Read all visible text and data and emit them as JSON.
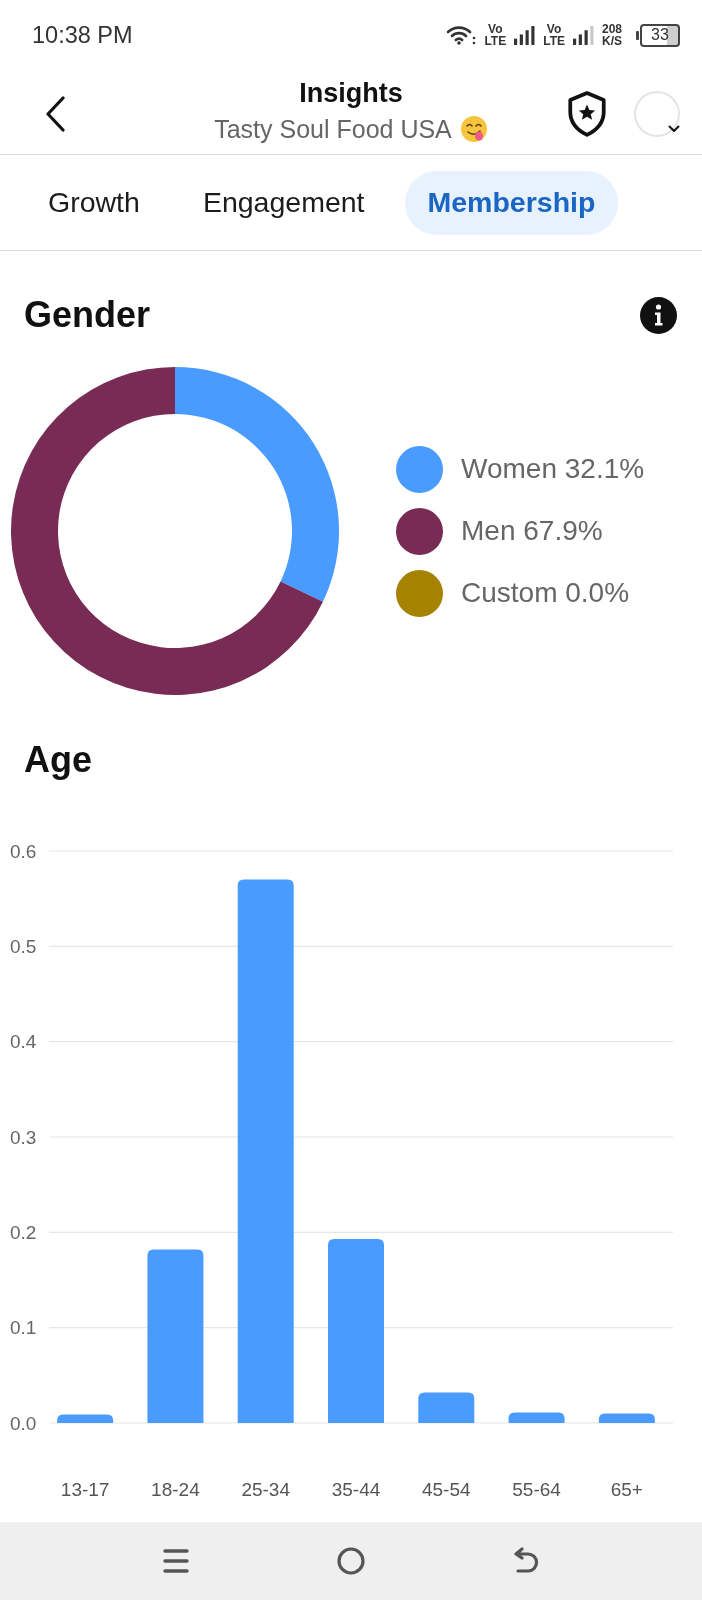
{
  "status_bar": {
    "time": "10:38 PM",
    "sims": [
      {
        "top": "Vo",
        "bottom": "LTE"
      },
      {
        "top": "Vo",
        "bottom": "LTE"
      }
    ],
    "speed": {
      "value": "208",
      "unit": "K/S"
    },
    "battery": "33"
  },
  "header": {
    "title": "Insights",
    "subtitle": "Tasty Soul Food USA"
  },
  "tabs": [
    {
      "label": "Growth",
      "selected": false
    },
    {
      "label": "Engagement",
      "selected": false
    },
    {
      "label": "Membership",
      "selected": true
    }
  ],
  "gender": {
    "title": "Gender",
    "legend": [
      {
        "color": "#4a9bff"
      },
      {
        "color": "#772b55"
      },
      {
        "color": "#a58200"
      }
    ],
    "chart_data": {
      "type": "donut",
      "categories": [
        "Women",
        "Men",
        "Custom"
      ],
      "values": [
        32.1,
        67.9,
        0.0
      ],
      "value_labels": [
        "32.1%",
        "67.9%",
        "0.0%"
      ]
    }
  },
  "age": {
    "title": "Age",
    "chart_data": {
      "type": "bar",
      "categories": [
        "13-17",
        "18-24",
        "25-34",
        "35-44",
        "45-54",
        "55-64",
        "65+"
      ],
      "values": [
        0.009,
        0.182,
        0.57,
        0.193,
        0.032,
        0.011,
        0.01
      ],
      "ylim": [
        0,
        0.6
      ],
      "yticks": [
        {
          "value": 0,
          "label": "0.0"
        },
        {
          "value": 0.1,
          "label": "0.1"
        },
        {
          "value": 0.2,
          "label": "0.2"
        },
        {
          "value": 0.3,
          "label": "0.3"
        },
        {
          "value": 0.4,
          "label": "0.4"
        },
        {
          "value": 0.5,
          "label": "0.5"
        },
        {
          "value": 0.6,
          "label": "0.6"
        }
      ],
      "grid": true
    }
  }
}
